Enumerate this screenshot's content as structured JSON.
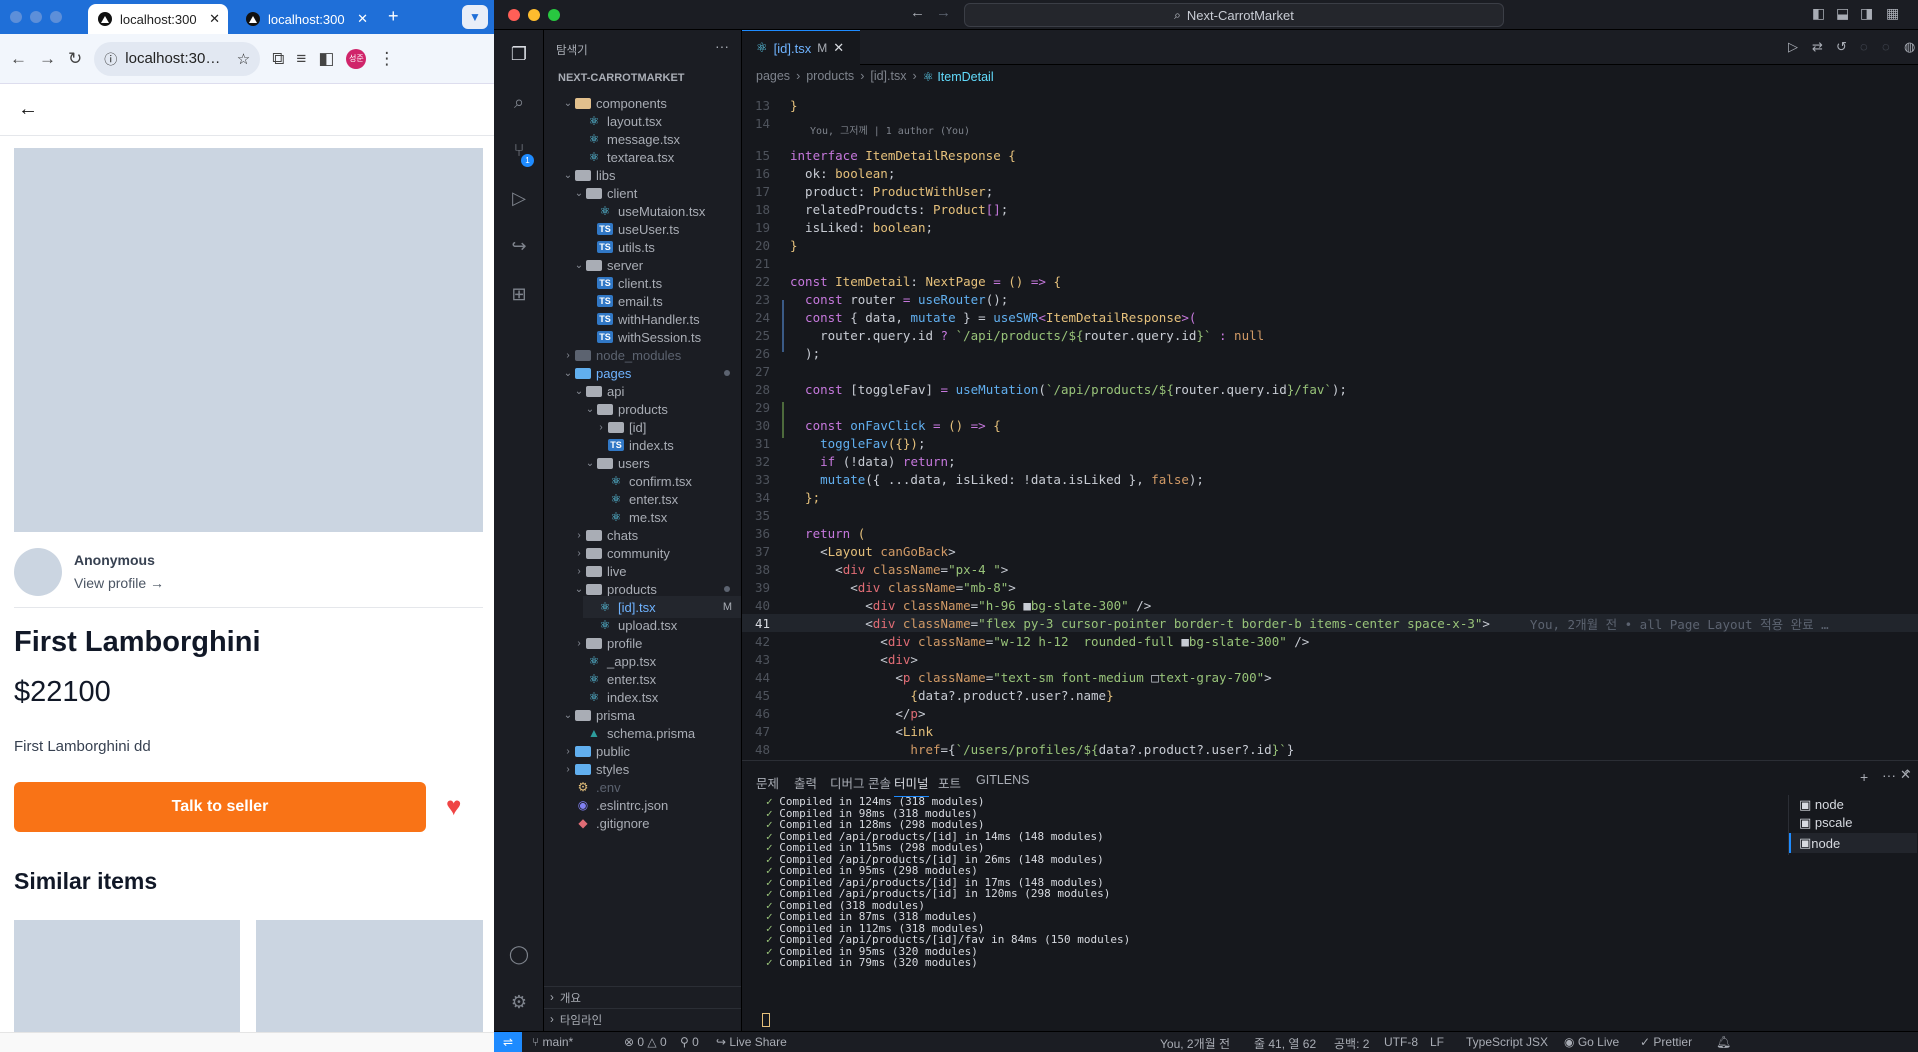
{
  "browser": {
    "tabs": [
      {
        "label": "localhost:300"
      },
      {
        "label": "localhost:300"
      }
    ],
    "address": "localhost:30…",
    "profile_initial": "성준",
    "product": {
      "seller": "Anonymous",
      "view_profile": "View profile →",
      "name": "First Lamborghini",
      "price": "$22100",
      "description": "First Lamborghini dd",
      "cta": "Talk to seller",
      "similar_title": "Similar items"
    }
  },
  "vscode": {
    "search": "Next-CarrotMarket",
    "sidebar_title": "탐색기",
    "root": "NEXT-CARROTMARKET",
    "tree": [
      {
        "label": "components",
        "depth": 1,
        "kind": "folder-open",
        "color": "#e2c08d"
      },
      {
        "label": "layout.tsx",
        "depth": 2,
        "kind": "react"
      },
      {
        "label": "message.tsx",
        "depth": 2,
        "kind": "react"
      },
      {
        "label": "textarea.tsx",
        "depth": 2,
        "kind": "react"
      },
      {
        "label": "libs",
        "depth": 1,
        "kind": "folder-open",
        "color": "#a9adb5"
      },
      {
        "label": "client",
        "depth": 2,
        "kind": "folder-open",
        "color": "#a9adb5"
      },
      {
        "label": "useMutaion.tsx",
        "depth": 3,
        "kind": "react"
      },
      {
        "label": "useUser.ts",
        "depth": 3,
        "kind": "ts"
      },
      {
        "label": "utils.ts",
        "depth": 3,
        "kind": "ts"
      },
      {
        "label": "server",
        "depth": 2,
        "kind": "folder-open",
        "color": "#a9adb5"
      },
      {
        "label": "client.ts",
        "depth": 3,
        "kind": "ts"
      },
      {
        "label": "email.ts",
        "depth": 3,
        "kind": "ts"
      },
      {
        "label": "withHandler.ts",
        "depth": 3,
        "kind": "ts"
      },
      {
        "label": "withSession.ts",
        "depth": 3,
        "kind": "ts"
      },
      {
        "label": "node_modules",
        "depth": 1,
        "kind": "folder",
        "color": "#5c6370"
      },
      {
        "label": "pages",
        "depth": 1,
        "kind": "folder-open",
        "color": "#61afef",
        "dot": true
      },
      {
        "label": "api",
        "depth": 2,
        "kind": "folder-open",
        "color": "#a9adb5"
      },
      {
        "label": "products",
        "depth": 3,
        "kind": "folder-open",
        "color": "#a9adb5"
      },
      {
        "label": "[id]",
        "depth": 4,
        "kind": "folder",
        "color": "#a9adb5"
      },
      {
        "label": "index.ts",
        "depth": 4,
        "kind": "ts"
      },
      {
        "label": "users",
        "depth": 3,
        "kind": "folder-open",
        "color": "#a9adb5"
      },
      {
        "label": "confirm.tsx",
        "depth": 4,
        "kind": "react"
      },
      {
        "label": "enter.tsx",
        "depth": 4,
        "kind": "react"
      },
      {
        "label": "me.tsx",
        "depth": 4,
        "kind": "react"
      },
      {
        "label": "chats",
        "depth": 2,
        "kind": "folder",
        "color": "#a9adb5"
      },
      {
        "label": "community",
        "depth": 2,
        "kind": "folder",
        "color": "#a9adb5"
      },
      {
        "label": "live",
        "depth": 2,
        "kind": "folder",
        "color": "#a9adb5"
      },
      {
        "label": "products",
        "depth": 2,
        "kind": "folder-open",
        "color": "#a9adb5",
        "dot": true
      },
      {
        "label": "[id].tsx",
        "depth": 3,
        "kind": "react",
        "active": true,
        "badge": "M"
      },
      {
        "label": "upload.tsx",
        "depth": 3,
        "kind": "react"
      },
      {
        "label": "profile",
        "depth": 2,
        "kind": "folder",
        "color": "#a9adb5"
      },
      {
        "label": "_app.tsx",
        "depth": 2,
        "kind": "react"
      },
      {
        "label": "enter.tsx",
        "depth": 2,
        "kind": "react"
      },
      {
        "label": "index.tsx",
        "depth": 2,
        "kind": "react"
      },
      {
        "label": "prisma",
        "depth": 1,
        "kind": "folder-open",
        "color": "#a9adb5"
      },
      {
        "label": "schema.prisma",
        "depth": 2,
        "kind": "prisma"
      },
      {
        "label": "public",
        "depth": 1,
        "kind": "folder",
        "color": "#61afef"
      },
      {
        "label": "styles",
        "depth": 1,
        "kind": "folder",
        "color": "#61afef"
      },
      {
        "label": ".env",
        "depth": 1,
        "kind": "env"
      },
      {
        "label": ".eslintrc.json",
        "depth": 1,
        "kind": "eslint"
      },
      {
        "label": ".gitignore",
        "depth": 1,
        "kind": "git"
      }
    ],
    "outline": "개요",
    "timeline": "타임라인",
    "editor_tab": "[id].tsx",
    "editor_tab_badge": "M",
    "breadcrumb": [
      "pages",
      ">",
      "products",
      ">",
      "[id].tsx",
      ">",
      "ItemDetail"
    ],
    "blame_header": "You, 그저께 | 1 author (You)",
    "inline_blame": "You, 2개월 전 • all Page Layout 적용 완료 …",
    "code": [
      {
        "n": "13",
        "t": [
          [
            "}",
            "ty"
          ]
        ]
      },
      {
        "n": "14",
        "t": []
      },
      {
        "n": "15",
        "t": [
          [
            "interface ",
            "kw"
          ],
          [
            "ItemDetailResponse ",
            "ty"
          ],
          [
            "{",
            "ty"
          ]
        ]
      },
      {
        "n": "16",
        "t": [
          [
            "  ok: ",
            "pl"
          ],
          [
            "boolean",
            "ty"
          ],
          [
            ";",
            "pl"
          ]
        ]
      },
      {
        "n": "17",
        "t": [
          [
            "  product: ",
            "pl"
          ],
          [
            "ProductWithUser",
            "ty"
          ],
          [
            ";",
            "pl"
          ]
        ]
      },
      {
        "n": "18",
        "t": [
          [
            "  relatedProudcts: ",
            "pl"
          ],
          [
            "Product",
            "ty"
          ],
          [
            "[]",
            "kw"
          ],
          [
            ";",
            "pl"
          ]
        ]
      },
      {
        "n": "19",
        "t": [
          [
            "  isLiked: ",
            "pl"
          ],
          [
            "boolean",
            "ty"
          ],
          [
            ";",
            "pl"
          ]
        ]
      },
      {
        "n": "20",
        "t": [
          [
            "}",
            "ty"
          ]
        ]
      },
      {
        "n": "21",
        "t": []
      },
      {
        "n": "22",
        "t": [
          [
            "const ",
            "kw"
          ],
          [
            "ItemDetail",
            "ty"
          ],
          [
            ": ",
            "pl"
          ],
          [
            "NextPage ",
            "ty"
          ],
          [
            "= ",
            "kw"
          ],
          [
            "() ",
            "ty"
          ],
          [
            "=> ",
            "kw"
          ],
          [
            "{",
            "ty"
          ]
        ]
      },
      {
        "n": "23",
        "t": [
          [
            "  const ",
            "kw"
          ],
          [
            "router ",
            "pl"
          ],
          [
            "= ",
            "kw"
          ],
          [
            "useRouter",
            "fn"
          ],
          [
            "();",
            "pl"
          ]
        ]
      },
      {
        "n": "24",
        "t": [
          [
            "  const ",
            "kw"
          ],
          [
            "{ data, ",
            "pl"
          ],
          [
            "mutate ",
            "fn"
          ],
          [
            "} = ",
            "pl"
          ],
          [
            "useSWR",
            "fn"
          ],
          [
            "<",
            "kw"
          ],
          [
            "ItemDetailResponse",
            "ty"
          ],
          [
            ">(",
            "kw"
          ]
        ]
      },
      {
        "n": "25",
        "t": [
          [
            "    router.query.id ",
            "pl"
          ],
          [
            "? ",
            "kw"
          ],
          [
            "`/api/products/${",
            "st"
          ],
          [
            "router.query.id",
            "pl"
          ],
          [
            "}` ",
            "st"
          ],
          [
            ": ",
            "kw"
          ],
          [
            "null",
            "at"
          ]
        ]
      },
      {
        "n": "26",
        "t": [
          [
            "  );",
            "pl"
          ]
        ]
      },
      {
        "n": "27",
        "t": []
      },
      {
        "n": "28",
        "t": [
          [
            "  const ",
            "kw"
          ],
          [
            "[toggleFav] ",
            "pl"
          ],
          [
            "= ",
            "kw"
          ],
          [
            "useMutation",
            "fn"
          ],
          [
            "(",
            "pl"
          ],
          [
            "`/api/products/${",
            "st"
          ],
          [
            "router.query.id",
            "pl"
          ],
          [
            "}/fav`",
            "st"
          ],
          [
            ");",
            "pl"
          ]
        ]
      },
      {
        "n": "29",
        "t": []
      },
      {
        "n": "30",
        "t": [
          [
            "  const ",
            "kw"
          ],
          [
            "onFavClick ",
            "fn"
          ],
          [
            "= ",
            "kw"
          ],
          [
            "() ",
            "ty"
          ],
          [
            "=> ",
            "kw"
          ],
          [
            "{",
            "ty"
          ]
        ]
      },
      {
        "n": "31",
        "t": [
          [
            "    ",
            "pl"
          ],
          [
            "toggleFav",
            "fn"
          ],
          [
            "({",
            "ty"
          ],
          [
            "})",
            "ty"
          ],
          [
            ";",
            "pl"
          ]
        ]
      },
      {
        "n": "32",
        "t": [
          [
            "    if ",
            "kw"
          ],
          [
            "(!",
            "pl"
          ],
          [
            "data",
            "pl"
          ],
          [
            ") ",
            "pl"
          ],
          [
            "return",
            "kw"
          ],
          [
            ";",
            "pl"
          ]
        ]
      },
      {
        "n": "33",
        "t": [
          [
            "    ",
            "pl"
          ],
          [
            "mutate",
            "fn"
          ],
          [
            "({ ...data, isLiked: !data.isLiked }, ",
            "pl"
          ],
          [
            "false",
            "at"
          ],
          [
            ");",
            "pl"
          ]
        ]
      },
      {
        "n": "34",
        "t": [
          [
            "  };",
            "ty"
          ]
        ]
      },
      {
        "n": "35",
        "t": []
      },
      {
        "n": "36",
        "t": [
          [
            "  return ",
            "kw"
          ],
          [
            "(",
            "ty"
          ]
        ]
      },
      {
        "n": "37",
        "t": [
          [
            "    <",
            "pl"
          ],
          [
            "Layout ",
            "ty"
          ],
          [
            "canGoBack",
            "at"
          ],
          [
            ">",
            "pl"
          ]
        ]
      },
      {
        "n": "38",
        "t": [
          [
            "      <",
            "pl"
          ],
          [
            "div ",
            "pr"
          ],
          [
            "className",
            "at"
          ],
          [
            "=",
            "pl"
          ],
          [
            "\"px-4 \"",
            "st"
          ],
          [
            ">",
            "pl"
          ]
        ]
      },
      {
        "n": "39",
        "t": [
          [
            "        <",
            "pl"
          ],
          [
            "div ",
            "pr"
          ],
          [
            "className",
            "at"
          ],
          [
            "=",
            "pl"
          ],
          [
            "\"mb-8\"",
            "st"
          ],
          [
            ">",
            "pl"
          ]
        ]
      },
      {
        "n": "40",
        "t": [
          [
            "          <",
            "pl"
          ],
          [
            "div ",
            "pr"
          ],
          [
            "className",
            "at"
          ],
          [
            "=",
            "pl"
          ],
          [
            "\"h-96 ",
            "st"
          ],
          [
            "■",
            "pl"
          ],
          [
            "bg-slate-300\" ",
            "st"
          ],
          [
            "/>",
            "pl"
          ]
        ]
      },
      {
        "n": "41",
        "t": [
          [
            "          <",
            "pl"
          ],
          [
            "div ",
            "pr"
          ],
          [
            "className",
            "at"
          ],
          [
            "=",
            "pl"
          ],
          [
            "\"flex py-3 cursor-pointer border-t border-b items-center space-x-3\"",
            "st"
          ],
          [
            ">",
            "pl"
          ]
        ],
        "current": true
      },
      {
        "n": "42",
        "t": [
          [
            "            <",
            "pl"
          ],
          [
            "div ",
            "pr"
          ],
          [
            "className",
            "at"
          ],
          [
            "=",
            "pl"
          ],
          [
            "\"w-12 h-12  rounded-full ",
            "st"
          ],
          [
            "■",
            "pl"
          ],
          [
            "bg-slate-300\" ",
            "st"
          ],
          [
            "/>",
            "pl"
          ]
        ]
      },
      {
        "n": "43",
        "t": [
          [
            "            <",
            "pl"
          ],
          [
            "div",
            "pr"
          ],
          [
            ">",
            "pl"
          ]
        ]
      },
      {
        "n": "44",
        "t": [
          [
            "              <",
            "pl"
          ],
          [
            "p ",
            "pr"
          ],
          [
            "className",
            "at"
          ],
          [
            "=",
            "pl"
          ],
          [
            "\"text-sm font-medium ",
            "st"
          ],
          [
            "□",
            "pl"
          ],
          [
            "text-gray-700\"",
            "st"
          ],
          [
            ">",
            "pl"
          ]
        ]
      },
      {
        "n": "45",
        "t": [
          [
            "                {",
            "ty"
          ],
          [
            "data?.product?.user?.name",
            "pl"
          ],
          [
            "}",
            "ty"
          ]
        ]
      },
      {
        "n": "46",
        "t": [
          [
            "              </",
            "pl"
          ],
          [
            "p",
            "pr"
          ],
          [
            ">",
            "pl"
          ]
        ]
      },
      {
        "n": "47",
        "t": [
          [
            "              <",
            "pl"
          ],
          [
            "Link",
            "ty"
          ]
        ]
      },
      {
        "n": "48",
        "t": [
          [
            "                ",
            "pl"
          ],
          [
            "href",
            "at"
          ],
          [
            "={",
            "pl"
          ],
          [
            "`/users/profiles/${",
            "st"
          ],
          [
            "data?.product?.user?.id",
            "pl"
          ],
          [
            "}`",
            "st"
          ],
          [
            "}",
            "pl"
          ]
        ]
      }
    ],
    "panel_tabs": [
      "문제",
      "출력",
      "디버그 콘솔",
      "터미널",
      "포트",
      "GITLENS"
    ],
    "terminal": [
      "✓ Compiled in 124ms (318 modules)",
      "✓ Compiled in 98ms (318 modules)",
      "✓ Compiled in 128ms (298 modules)",
      "✓ Compiled /api/products/[id] in 14ms (148 modules)",
      "✓ Compiled in 115ms (298 modules)",
      "✓ Compiled /api/products/[id] in 26ms (148 modules)",
      "✓ Compiled in 95ms (298 modules)",
      "✓ Compiled /api/products/[id] in 17ms (148 modules)",
      "✓ Compiled /api/products/[id] in 120ms (298 modules)",
      "✓ Compiled (318 modules)",
      "✓ Compiled in 87ms (318 modules)",
      "✓ Compiled in 112ms (318 modules)",
      "✓ Compiled /api/products/[id]/fav in 84ms (150 modules)",
      "✓ Compiled in 95ms (320 modules)",
      "✓ Compiled in 79ms (320 modules)"
    ],
    "terminals": [
      "node",
      "pscale",
      "node"
    ],
    "status": {
      "branch": "main*",
      "errors": "0",
      "warnings": "0",
      "ports": "0",
      "live_share": "Live Share",
      "blame": "You, 2개월 전",
      "position": "줄 41, 열 62",
      "spaces": "공백: 2",
      "encoding": "UTF-8",
      "eol": "LF",
      "language": "TypeScript JSX",
      "go_live": "Go Live",
      "prettier": "Prettier"
    },
    "colors": {
      "accent": "#1e8bff",
      "folder": "#e2c08d",
      "ts": "#3178c6",
      "react": "#61dafb"
    }
  }
}
